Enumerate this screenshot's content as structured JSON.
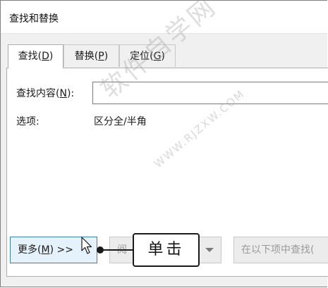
{
  "window": {
    "title": "查找和替换"
  },
  "tabs": [
    {
      "label_pre": "查找(",
      "key": "D",
      "label_post": ")"
    },
    {
      "label_pre": "替换(",
      "key": "P",
      "label_post": ")"
    },
    {
      "label_pre": "定位(",
      "key": "G",
      "label_post": ")"
    }
  ],
  "find": {
    "label_pre": "查找内容(",
    "key": "N",
    "label_post": "):",
    "value": ""
  },
  "options": {
    "label": "选项:",
    "value": "区分全/半角"
  },
  "buttons": {
    "more_pre": "更多(",
    "more_key": "M",
    "more_post": ") >>",
    "reading_highlight_partial": "阅",
    "find_in": "在以下项中查找("
  },
  "callout": {
    "text": "单击"
  },
  "watermark": {
    "main": "软件自学网",
    "sub": "WWW.RJZXW.COM"
  },
  "colors": {
    "dialog_bg": "#f0f0f0",
    "primary_border": "#3c7fb1",
    "primary_bg": "#e5f1fb"
  },
  "icons": [
    "mouse-pointer-icon",
    "dropdown-caret-icon"
  ]
}
